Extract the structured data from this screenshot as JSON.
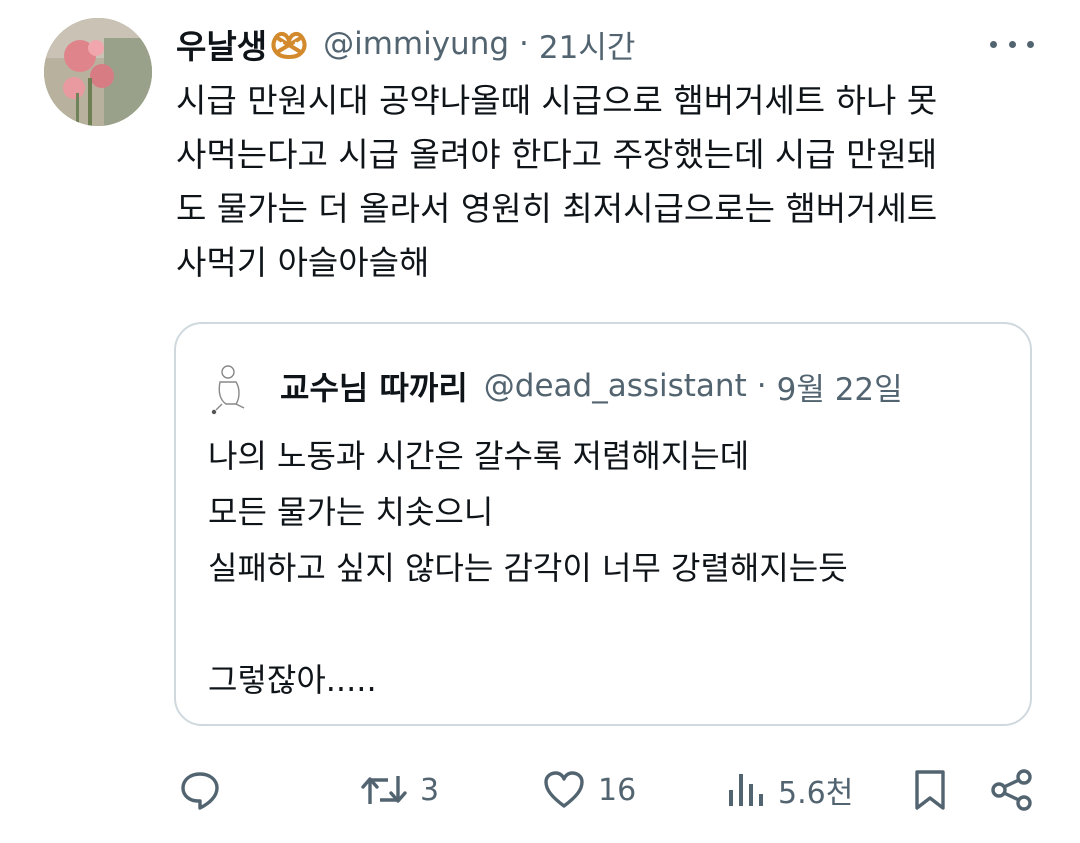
{
  "tweet": {
    "display_name": "우날생",
    "name_emoji_icon": "pretzel-icon",
    "handle": "@immiyung",
    "separator": "·",
    "time": "21시간",
    "more_icon": "more-dots-icon",
    "body_lines": [
      "시급 만원시대 공약나올때 시급으로 햄버거세트 하나 못",
      "사먹는다고 시급 올려야 한다고 주장했는데 시급 만원돼",
      "도 물가는 더 올라서 영원히 최저시급으로는 햄버거세트",
      "사먹기 아슬아슬해"
    ]
  },
  "quote": {
    "display_name": "교수님 따까리",
    "handle": "@dead_assistant",
    "separator": "·",
    "date": "9월 22일",
    "body_lines": [
      "나의 노동과 시간은 갈수록 저렴해지는데",
      "모든 물가는 치솟으니",
      "실패하고 싶지 않다는 감각이 너무 강렬해지는듯",
      "",
      "그렇잖아....."
    ]
  },
  "actions": {
    "reply": {
      "icon": "reply-icon",
      "count": ""
    },
    "retweet": {
      "icon": "retweet-icon",
      "count": "3"
    },
    "like": {
      "icon": "heart-icon",
      "count": "16"
    },
    "views": {
      "icon": "views-chart-icon",
      "count": "5.6천"
    },
    "bookmark": {
      "icon": "bookmark-icon"
    },
    "share": {
      "icon": "share-icon"
    }
  },
  "colors": {
    "text_primary": "#0f1419",
    "text_secondary": "#536471",
    "border": "#cfd9de"
  }
}
